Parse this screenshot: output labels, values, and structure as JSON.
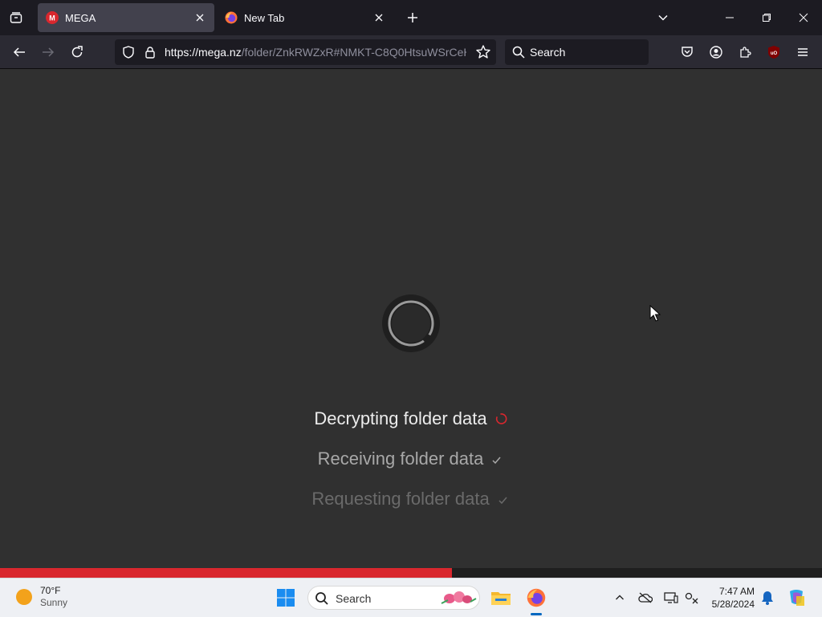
{
  "browser": {
    "tabs": [
      {
        "title": "MEGA",
        "favicon": "mega-logo-icon",
        "active": true
      },
      {
        "title": "New Tab",
        "favicon": "firefox-logo-icon",
        "active": false
      }
    ],
    "url_host": "https://mega.nz",
    "url_path": "/folder/ZnkRWZxR#NMKT-C8Q0HtsuWSrCeH",
    "search_placeholder": "Search",
    "icons": {
      "tab_list": "tab-list-icon",
      "new_tab": "plus-icon",
      "list_all_tabs": "chevron-down-icon",
      "back": "back-arrow-icon",
      "forward": "forward-arrow-icon",
      "reload": "reload-icon",
      "tracking_protection": "shield-icon",
      "site_security": "lock-icon",
      "bookmark": "star-icon",
      "pocket": "pocket-icon",
      "account": "account-icon",
      "extensions": "puzzle-icon",
      "ublock": "ublock-icon",
      "menu": "hamburger-menu-icon"
    }
  },
  "page": {
    "steps": [
      {
        "label": "Decrypting folder data",
        "status": "in-progress"
      },
      {
        "label": "Receiving folder data",
        "status": "done"
      },
      {
        "label": "Requesting folder data",
        "status": "done"
      }
    ],
    "progress": 0.55,
    "accent_color": "#d9272e"
  },
  "taskbar": {
    "weather_temp": "70°F",
    "weather_condition": "Sunny",
    "search_placeholder": "Search",
    "time": "7:47 AM",
    "date": "5/28/2024",
    "pinned": [
      "file-explorer-icon",
      "firefox-icon"
    ],
    "tray_icons": [
      "chevron-up-icon",
      "onedrive-icon",
      "display-icon",
      "network-icon",
      "bell-icon",
      "copilot-icon"
    ]
  }
}
